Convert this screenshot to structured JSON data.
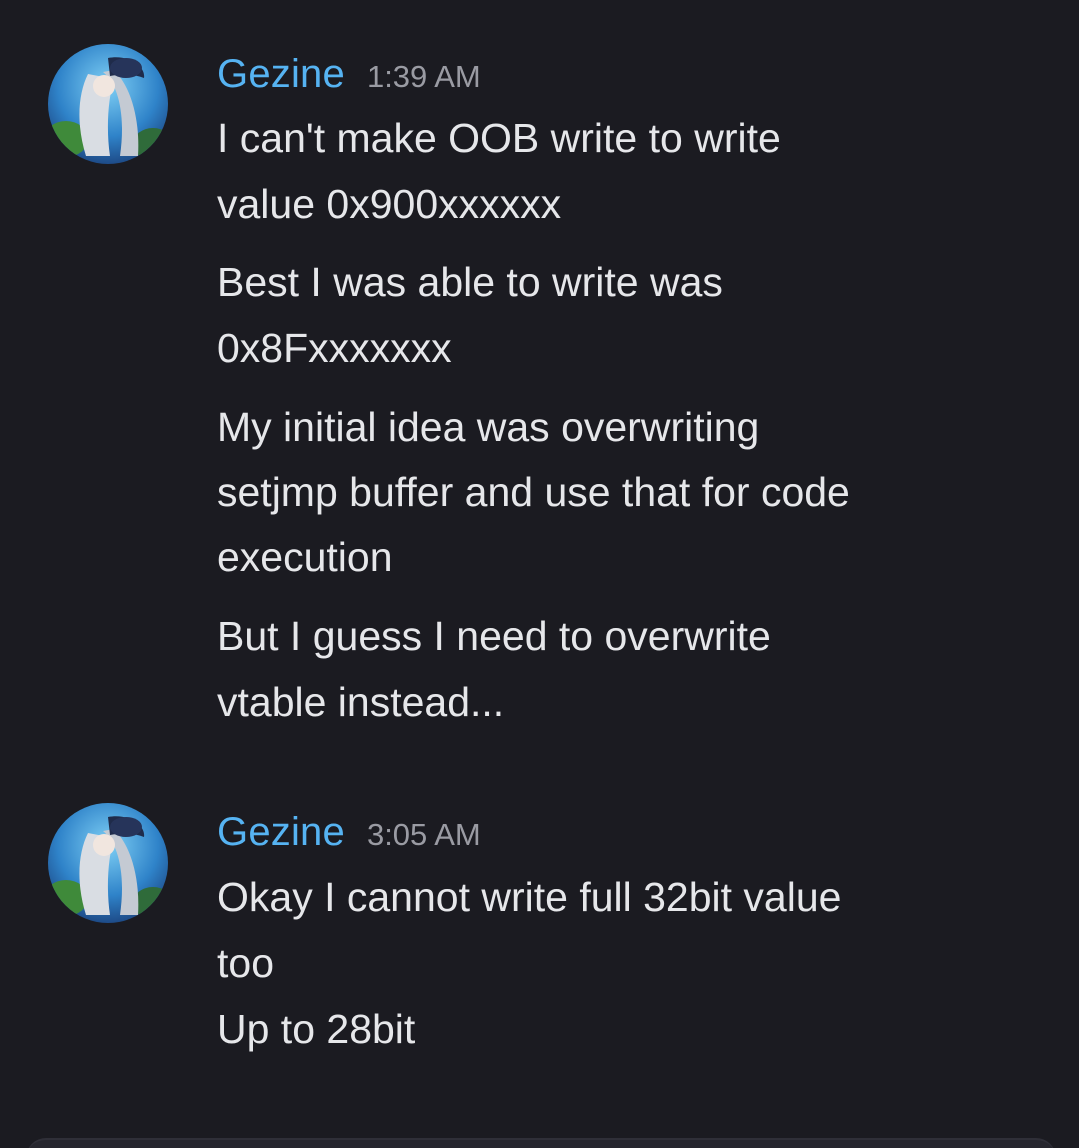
{
  "messages": [
    {
      "username": "Gezine",
      "timestamp": "1:39 AM",
      "avatar_icon": "anime-avatar-icon",
      "lines": [
        "I can't make OOB write to write",
        "value 0x900xxxxxx",
        "Best I was able to write was",
        "0x8Fxxxxxxx",
        "My initial idea was overwriting",
        "setjmp buffer and use that for code",
        "execution",
        "But I guess I need to overwrite",
        "vtable instead..."
      ]
    },
    {
      "username": "Gezine",
      "timestamp": "3:05 AM",
      "avatar_icon": "anime-avatar-icon",
      "lines": [
        "Okay I cannot write full 32bit value",
        "too",
        "Up to 28bit"
      ]
    }
  ],
  "colors": {
    "background": "#1b1b21",
    "username": "#56b3f2",
    "timestamp": "#9a9ba3",
    "text": "#e6e7ea"
  }
}
